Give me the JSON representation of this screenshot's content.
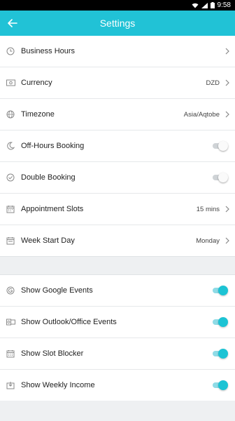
{
  "status_bar": {
    "time": "9:58",
    "icons": [
      "wifi-icon",
      "signal-icon",
      "battery-icon"
    ]
  },
  "app_bar": {
    "title": "Settings",
    "back_icon": "arrow-left-icon"
  },
  "colors": {
    "accent": "#21c2d6",
    "toggle_on": "#1cc3d4"
  },
  "settings": [
    {
      "label": "Business Hours",
      "icon": "clock-icon",
      "value": ""
    },
    {
      "label": "Currency",
      "icon": "money-icon",
      "value": "DZD"
    },
    {
      "label": "Timezone",
      "icon": "globe-icon",
      "value": "Asia/Aqtobe"
    },
    {
      "label": "Off-Hours Booking",
      "icon": "moon-icon",
      "toggle": false
    },
    {
      "label": "Double Booking",
      "icon": "check-circle-icon",
      "toggle": false
    },
    {
      "label": "Appointment Slots",
      "icon": "calendar-icon",
      "value": "15 mins"
    },
    {
      "label": "Week Start Day",
      "icon": "calendar-icon",
      "value": "Monday"
    }
  ],
  "calendar_settings": [
    {
      "label": "Show Google Events",
      "icon": "google-icon",
      "toggle": true
    },
    {
      "label": "Show Outlook/Office Events",
      "icon": "outlook-icon",
      "toggle": true
    },
    {
      "label": "Show Slot Blocker",
      "icon": "calendar-grid-icon",
      "toggle": true
    },
    {
      "label": "Show Weekly Income",
      "icon": "income-icon",
      "toggle": true
    }
  ]
}
